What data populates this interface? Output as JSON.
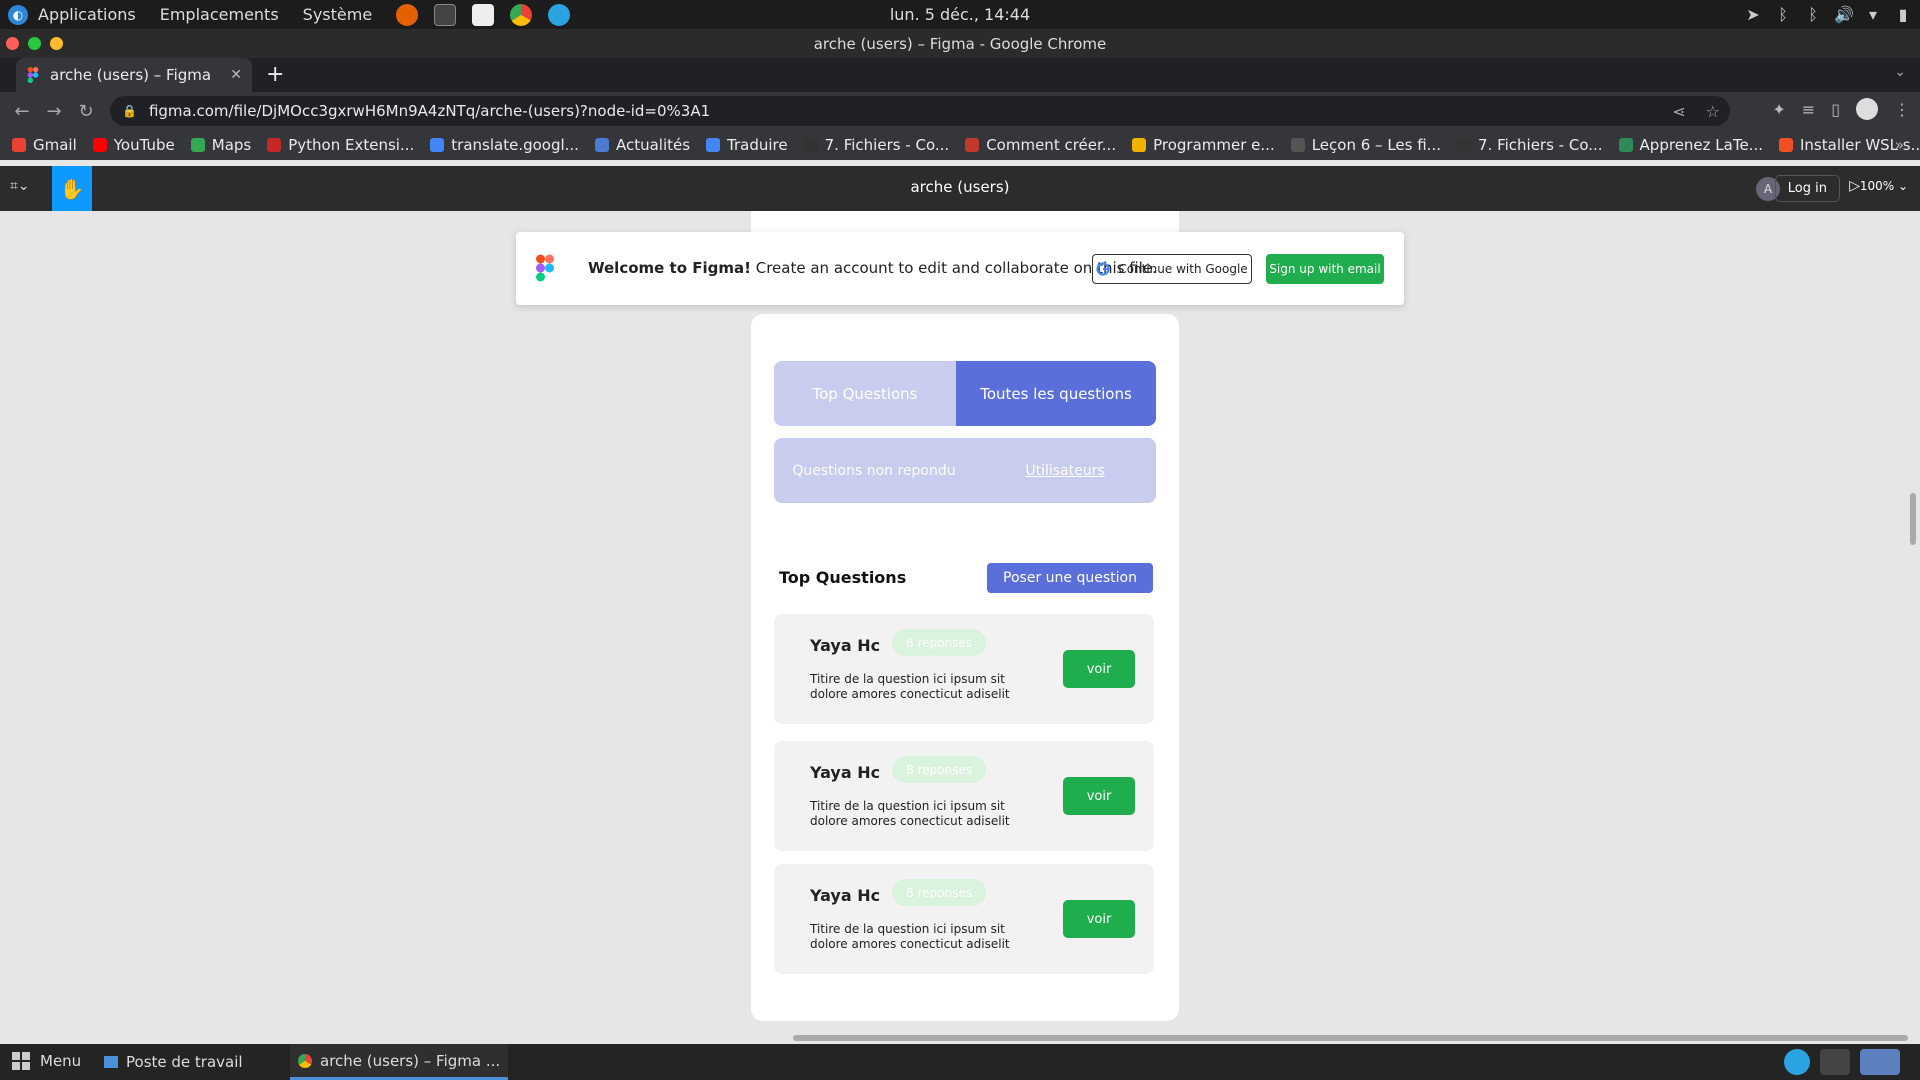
{
  "os_panel": {
    "menus": [
      "Applications",
      "Emplacements",
      "Système"
    ],
    "clock": "lun. 5 déc., 14:44"
  },
  "window": {
    "title": "arche (users) – Figma - Google Chrome"
  },
  "tab": {
    "title": "arche (users) – Figma"
  },
  "address": {
    "url": "figma.com/file/DjMOcc3gxrwH6Mn9A4zNTq/arche-(users)?node-id=0%3A1"
  },
  "bookmarks": [
    {
      "label": "Gmail",
      "color": "#ea4335"
    },
    {
      "label": "YouTube",
      "color": "#ff0000"
    },
    {
      "label": "Maps",
      "color": "#34a853"
    },
    {
      "label": "Python Extensi...",
      "color": "#c62828"
    },
    {
      "label": "translate.googl...",
      "color": "#4285f4"
    },
    {
      "label": "Actualités",
      "color": "#4a7bd0"
    },
    {
      "label": "Traduire",
      "color": "#4285f4"
    },
    {
      "label": "7. Fichiers - Co...",
      "color": "#333333"
    },
    {
      "label": "Comment créer...",
      "color": "#c0392b"
    },
    {
      "label": "Programmer e...",
      "color": "#f0b400"
    },
    {
      "label": "Leçon 6 – Les fi...",
      "color": "#555555"
    },
    {
      "label": "7. Fichiers - Co...",
      "color": "#333333"
    },
    {
      "label": "Apprenez LaTe...",
      "color": "#2e8b57"
    },
    {
      "label": "Installer WSL s...",
      "color": "#f25022"
    }
  ],
  "figma": {
    "file_title": "arche (users)",
    "avatar_initial": "A",
    "login_label": "Log in",
    "zoom": "100%"
  },
  "banner": {
    "welcome": "Welcome to Figma!",
    "message": " Create an account to edit and collaborate on this file.",
    "google_label": "Continue with Google",
    "email_label": "Sign up with email"
  },
  "design": {
    "tabs": [
      "Top Questions",
      "Toutes les questions"
    ],
    "tabs2": [
      "Questions non repondu",
      "Utilisateurs"
    ],
    "section_title": "Top Questions",
    "ask_label": "Poser une question",
    "questions": [
      {
        "author": "Yaya Hc",
        "badge": "8 reponses",
        "text": "Titire de la question ici ipsum sit dolore amores conecticut adiselit",
        "action": "voir"
      },
      {
        "author": "Yaya Hc",
        "badge": "8 reponses",
        "text": "Titire de la question ici ipsum sit dolore amores conecticut adiselit",
        "action": "voir"
      },
      {
        "author": "Yaya Hc",
        "badge": "8 reponses",
        "text": "Titire de la question ici ipsum sit dolore amores conecticut adiselit",
        "action": "voir"
      }
    ]
  },
  "taskbar": {
    "menu_label": "Menu",
    "items": [
      "Poste de travail",
      "arche (users) – Figma ..."
    ]
  },
  "colors": {
    "accent_blue": "#5b6fdb",
    "light_blue": "#c8cdef",
    "green": "#1fad4d",
    "badge_green": "#d9f3dc"
  }
}
